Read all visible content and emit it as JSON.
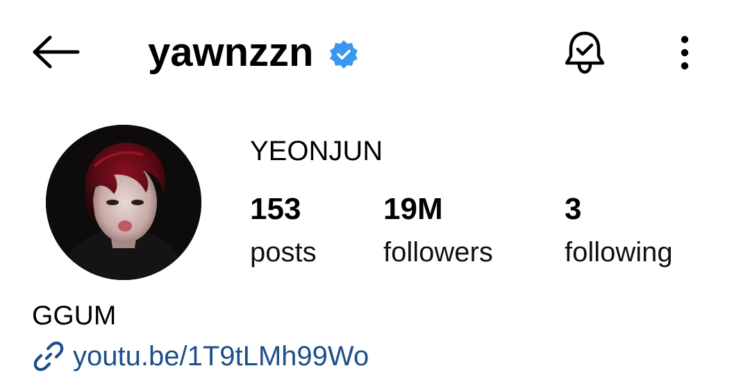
{
  "header": {
    "username": "yawnzzn",
    "back_icon": "arrow-left-icon",
    "verified_icon": "verified-badge-icon",
    "bell_icon": "bell-check-icon",
    "more_icon": "more-vertical-icon",
    "verified_color": "#3897f0"
  },
  "profile": {
    "display_name": "YEONJUN",
    "avatar": "avatar-photo",
    "stats": [
      {
        "count": "153",
        "label": "posts"
      },
      {
        "count": "19M",
        "label": "followers"
      },
      {
        "count": "3",
        "label": "following"
      }
    ]
  },
  "bio": {
    "text": "GGUM",
    "link_icon": "link-icon",
    "link": "youtu.be/1T9tLMh99Wo",
    "link_color": "#1d4e89"
  }
}
